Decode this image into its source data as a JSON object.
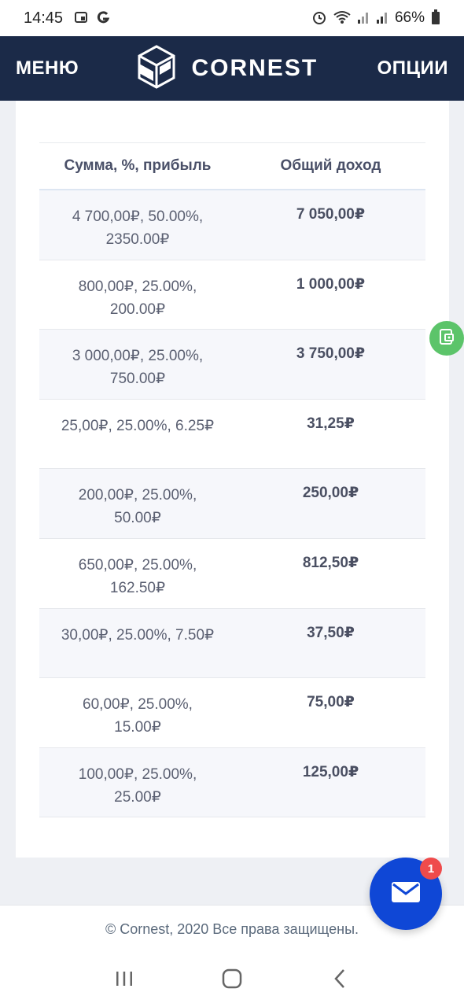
{
  "status": {
    "time": "14:45",
    "battery": "66%"
  },
  "header": {
    "menu_label": "МЕНЮ",
    "brand": "CORNEST",
    "options_label": "ОПЦИИ"
  },
  "table": {
    "headers": [
      "Сумма, %, прибыль",
      "Общий доход"
    ],
    "rows": [
      {
        "details": "4 700,00₽, 50.00%, 2350.00₽",
        "total": "7 050,00₽"
      },
      {
        "details": "800,00₽, 25.00%, 200.00₽",
        "total": "1 000,00₽"
      },
      {
        "details": "3 000,00₽, 25.00%, 750.00₽",
        "total": "3 750,00₽"
      },
      {
        "details": "25,00₽, 25.00%, 6.25₽",
        "total": "31,25₽"
      },
      {
        "details": "200,00₽, 25.00%, 50.00₽",
        "total": "250,00₽"
      },
      {
        "details": "650,00₽, 25.00%, 162.50₽",
        "total": "812,50₽"
      },
      {
        "details": "30,00₽, 25.00%, 7.50₽",
        "total": "37,50₽"
      },
      {
        "details": "60,00₽, 25.00%, 15.00₽",
        "total": "75,00₽"
      },
      {
        "details": "100,00₽, 25.00%, 25.00₽",
        "total": "125,00₽"
      }
    ]
  },
  "footer": {
    "copyright": "© Cornest, 2020 Все права защищены."
  },
  "fab": {
    "badge_count": "1",
    "icon": "mail-icon"
  },
  "colors": {
    "header_bg": "#1b2a48",
    "fab_bg": "#0f47d6",
    "badge_bg": "#ef4b4b",
    "side_icon_bg": "#5cc46a"
  }
}
